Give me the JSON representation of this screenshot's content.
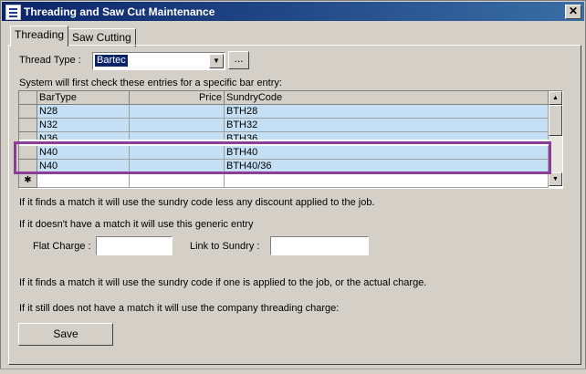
{
  "window": {
    "title": "Threading and Saw Cut Maintenance",
    "close_glyph": "✕"
  },
  "tabs": [
    {
      "label": "Threading"
    },
    {
      "label": "Saw Cutting"
    }
  ],
  "thread_type": {
    "label": "Thread Type :",
    "value": "Bartec",
    "browse_label": "..."
  },
  "grid": {
    "intro": "System will first check these entries for a specific bar entry:",
    "columns": [
      "BarType",
      "Price",
      "SundryCode"
    ],
    "rows": [
      {
        "bartype": "N28",
        "price": "",
        "sundry": "BTH28"
      },
      {
        "bartype": "N32",
        "price": "",
        "sundry": "BTH32"
      },
      {
        "bartype": "N36",
        "price": "",
        "sundry": "BTH36"
      },
      {
        "bartype": "N40",
        "price": "",
        "sundry": "BTH40"
      },
      {
        "bartype": "N40",
        "price": "",
        "sundry": "BTH40/36"
      }
    ],
    "new_row_marker": "✱"
  },
  "info1": "If it finds a match it will use the sundry code less any discount applied to the job.",
  "info2": "If it doesn't have a match it will use this generic entry",
  "flat_charge": {
    "label": "Flat Charge :",
    "value": ""
  },
  "link_sundry": {
    "label": "Link to Sundry :",
    "value": ""
  },
  "info3": "If it finds a match it will use the sundry code if one is applied to the job, or the actual charge.",
  "info4": "If it still does not have a match it will use the company threading charge:",
  "save_label": "Save",
  "colors": {
    "highlight_border": "#8e3c9a",
    "row_fill": "#c5dff5",
    "selection": "#0a246a"
  }
}
